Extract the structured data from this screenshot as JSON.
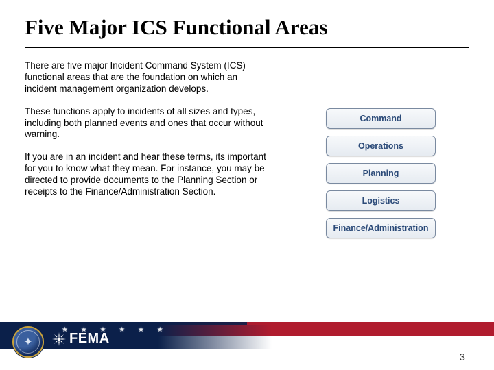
{
  "title": "Five Major ICS Functional Areas",
  "paragraphs": {
    "p1": "There are five major Incident Command System (ICS) functional areas that are the foundation on which an incident management organization develops.",
    "p2": "These functions apply to incidents of all sizes and types, including both planned events and ones that occur without warning.",
    "p3": "If you are in an incident and hear these terms, its important for you to know what they mean. For instance, you may be directed to provide documents to the Planning Section or receipts to the Finance/Administration Section."
  },
  "functions": {
    "f1": "Command",
    "f2": "Operations",
    "f3": "Planning",
    "f4": "Logistics",
    "f5": "Finance/Administration"
  },
  "footer": {
    "logo_text": "FEMA",
    "slide_number": "3"
  }
}
